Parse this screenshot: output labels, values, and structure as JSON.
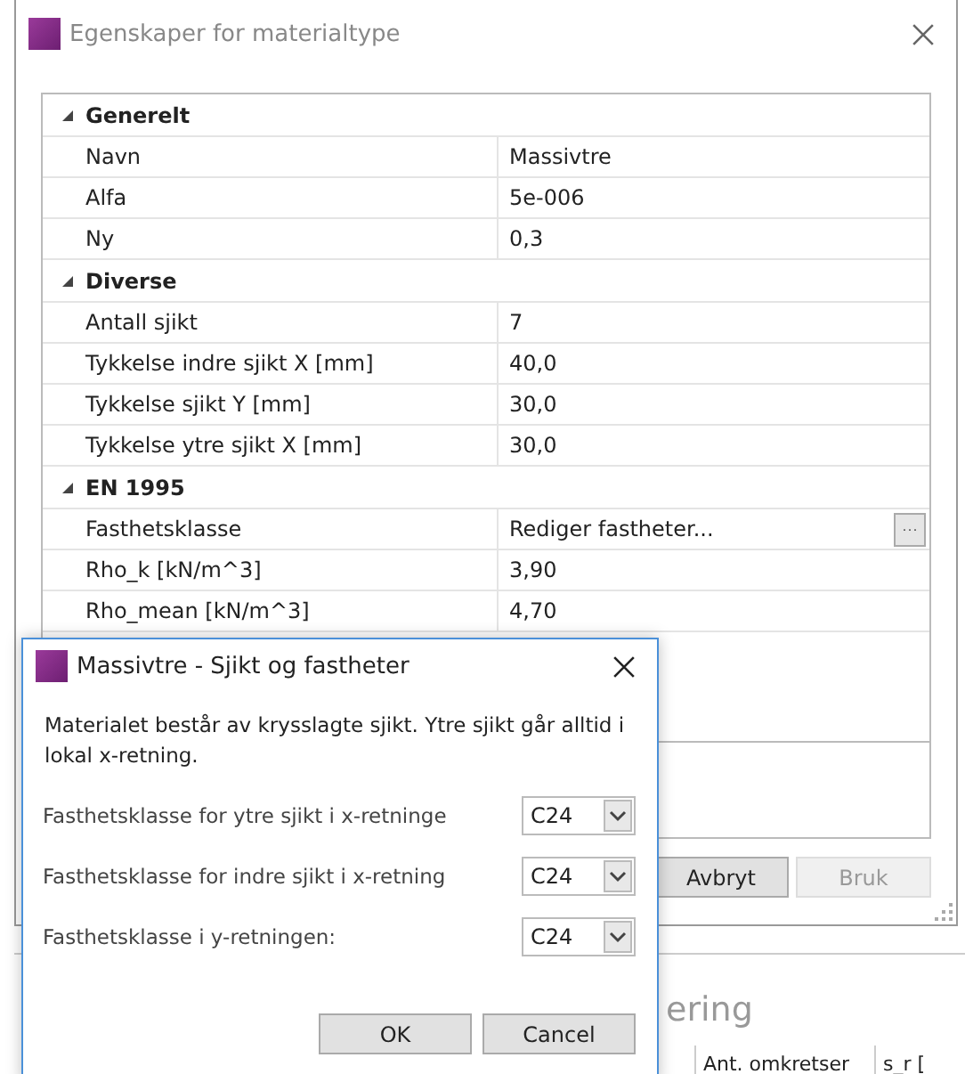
{
  "main_window": {
    "title": "Egenskaper for materialtype",
    "sections": [
      {
        "title": "Generelt",
        "expanded": true,
        "rows": [
          {
            "name": "Navn",
            "value": "Massivtre"
          },
          {
            "name": "Alfa",
            "value": "5e-006"
          },
          {
            "name": "Ny",
            "value": "0,3"
          }
        ]
      },
      {
        "title": "Diverse",
        "expanded": true,
        "rows": [
          {
            "name": "Antall sjikt",
            "value": "7"
          },
          {
            "name": "Tykkelse indre sjikt X [mm]",
            "value": "40,0"
          },
          {
            "name": "Tykkelse sjikt Y [mm]",
            "value": "30,0"
          },
          {
            "name": "Tykkelse ytre sjikt X [mm]",
            "value": "30,0"
          }
        ]
      },
      {
        "title": "EN 1995",
        "expanded": true,
        "rows": [
          {
            "name": "Fasthetsklasse",
            "value": "Rediger fastheter...",
            "button": "···"
          },
          {
            "name": "Rho_k [kN/m^3]",
            "value": "3,90"
          },
          {
            "name": "Rho_mean [kN/m^3]",
            "value": "4,70"
          }
        ]
      }
    ],
    "buttons": [
      {
        "label": "Avbryt",
        "disabled": false
      },
      {
        "label": "Bruk",
        "disabled": true
      }
    ]
  },
  "background": {
    "heading": "ering",
    "columns": [
      "Ant. omkretser",
      "s_r ["
    ]
  },
  "dialog": {
    "title": "Massivtre - Sjikt og fastheter",
    "description": "Materialet består av krysslagte sjikt. Ytre sjikt går alltid i lokal x-retning.",
    "fields": [
      {
        "label": "Fasthetsklasse for ytre sjikt i x-retninge",
        "value": "C24"
      },
      {
        "label": "Fasthetsklasse for indre sjikt i x-retning",
        "value": "C24"
      },
      {
        "label": "Fasthetsklasse i y-retningen:",
        "value": "C24"
      }
    ],
    "buttons": [
      "OK",
      "Cancel"
    ]
  }
}
